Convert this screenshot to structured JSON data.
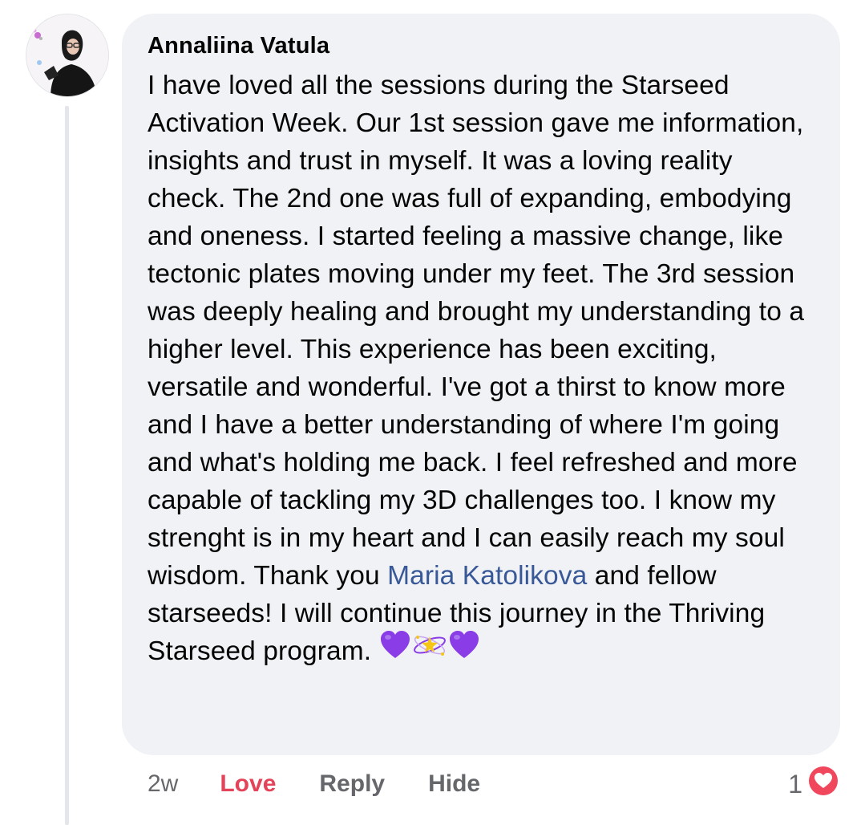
{
  "comment": {
    "author": "Annaliina Vatula",
    "text_before_mention": "I have loved all the sessions during the Starseed Activation Week. Our 1st session gave me information, insights and trust in myself. It was a loving reality check. The 2nd one was full of expanding, embodying and oneness. I started feeling a massive change, like tectonic plates moving under my feet. The 3rd session was deeply healing and brought my understanding to a higher level. This experience has been exciting, versatile and wonderful. I've got a thirst to know more and I have a better understanding of where I'm going and what's holding me back. I feel refreshed and more capable of tackling my 3D challenges too. I know my strenght is in my heart and I can easily reach my soul wisdom. Thank you ",
    "mention": "Maria Katolikova",
    "text_after_mention": " and fellow starseeds! I will continue this journey in the Thriving Starseed program. ",
    "emojis": [
      "purple-heart-icon",
      "planet-ring-icon",
      "purple-heart-icon"
    ]
  },
  "actions": {
    "time": "2w",
    "love": "Love",
    "reply": "Reply",
    "hide": "Hide"
  },
  "reaction": {
    "count": "1",
    "icon": "love-reaction-icon"
  },
  "colors": {
    "bubble": "#f0f2f5",
    "mention": "#385898",
    "love": "#e4445a",
    "secondary_text": "#65676b",
    "heart_emoji": "#8a3ce6"
  }
}
